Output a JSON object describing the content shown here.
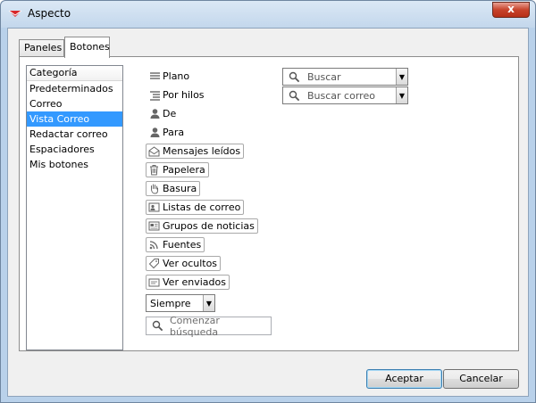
{
  "window": {
    "title": "Aspecto",
    "close_glyph": "x"
  },
  "tabs": [
    {
      "label": "Paneles",
      "active": false
    },
    {
      "label": "Botones",
      "active": true
    }
  ],
  "category_list": {
    "header": "Categoría",
    "items": [
      "Predeterminados",
      "Correo",
      "Vista Correo",
      "Redactar correo",
      "Espaciadores",
      "Mis botones"
    ],
    "selected": "Vista Correo"
  },
  "toolbar_items": {
    "plano": "Plano",
    "por_hilos": "Por hilos",
    "de": "De",
    "para": "Para",
    "mensajes_leidos": "Mensajes leídos",
    "papelera": "Papelera",
    "basura": "Basura",
    "listas_de_correo": "Listas de correo",
    "grupos_de_noticias": "Grupos de noticias",
    "fuentes": "Fuentes",
    "ver_ocultos": "Ver ocultos",
    "ver_enviados": "Ver enviados"
  },
  "siempre_select": {
    "value": "Siempre"
  },
  "comenzar_busqueda": {
    "placeholder": "Comenzar búsqueda"
  },
  "search_combos": {
    "buscar": "Buscar",
    "buscar_correo": "Buscar correo"
  },
  "buttons": {
    "accept": "Aceptar",
    "cancel": "Cancelar"
  },
  "colors": {
    "selection": "#3399ff",
    "title_bar": "#c3d7ec",
    "close_button": "#c7432b"
  }
}
